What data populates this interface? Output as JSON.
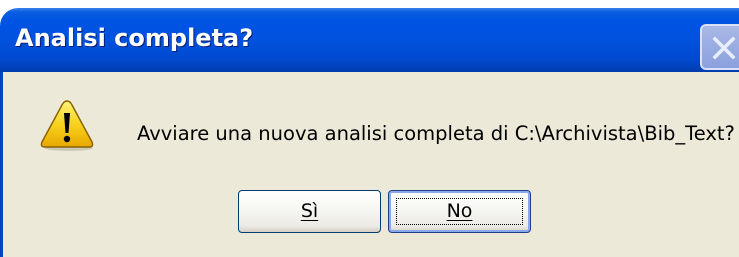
{
  "dialog": {
    "title": "Analisi completa?",
    "message": "Avviare una nuova analisi completa di C:\\Archivista\\Bib_Text?",
    "icon": "warning-icon"
  },
  "buttons": {
    "yes_label": "Sì",
    "no_label": "No",
    "default": "No"
  },
  "titlebar": {
    "close_icon": "close-icon"
  },
  "colors": {
    "titlebar": "#0054e3",
    "client": "#ece9d8",
    "warning": "#f6c500"
  }
}
